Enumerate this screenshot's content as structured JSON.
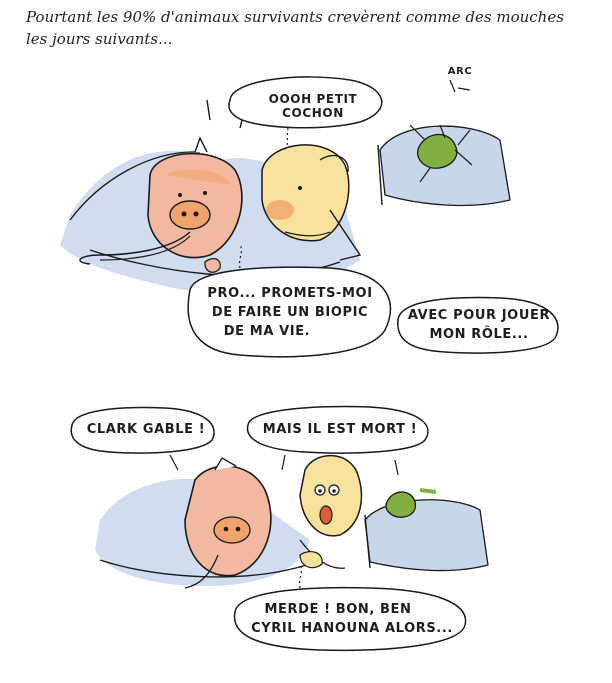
{
  "caption": "Pourtant les 90% d'animaux survivants crevèrent comme des mouches les jours suivants...",
  "panel1": {
    "sfx_arc": "ARC",
    "bubble_petit_cochon": "OOOH PETIT COCHON",
    "bubble_promets_line1": "PRO... PROMETS-MOI",
    "bubble_promets_line2": "DE FAIRE UN BIOPIC",
    "bubble_promets_line3": "DE MA VIE.",
    "bubble_avec_line1": "AVEC POUR JOUER",
    "bubble_avec_line2": "MON RÔLE..."
  },
  "panel2": {
    "bubble_clark": "CLARK GABLE !",
    "bubble_mais": "MAIS IL EST MORT !",
    "bubble_merde_line1": "MERDE ! BON, BEN",
    "bubble_merde_line2": "CYRIL HANOUNA ALORS..."
  },
  "colors": {
    "pig_pink": "#f2b9a0",
    "pig_orange": "#f0a36a",
    "sheet_blue": "#c8d6ec",
    "frog_green": "#7fb040",
    "ink": "#1a1a1a",
    "face_yellow": "#f6e29a"
  }
}
